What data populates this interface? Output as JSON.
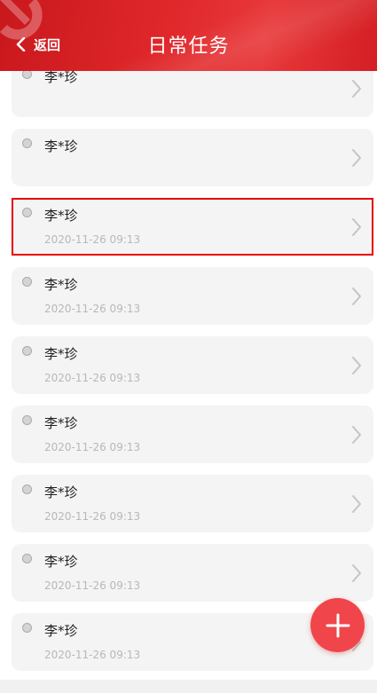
{
  "header": {
    "back_label": "返回",
    "title": "日常任务",
    "back_icon": "chevron-left-icon",
    "background_color": "#d9252a"
  },
  "tasks": [
    {
      "name": "李*珍",
      "time": ""
    },
    {
      "name": "李*珍",
      "time": ""
    },
    {
      "name": "李*珍",
      "time": "2020-11-26 09:13",
      "selected": true
    },
    {
      "name": "李*珍",
      "time": "2020-11-26 09:13"
    },
    {
      "name": "李*珍",
      "time": "2020-11-26 09:13"
    },
    {
      "name": "李*珍",
      "time": "2020-11-26 09:13"
    },
    {
      "name": "李*珍",
      "time": "2020-11-26 09:13"
    },
    {
      "name": "李*珍",
      "time": "2020-11-26 09:13"
    },
    {
      "name": "李*珍",
      "time": "2020-11-26 09:13"
    }
  ],
  "fab": {
    "icon": "plus-icon",
    "color": "#f0454a"
  },
  "colors": {
    "selected_outline": "#e60000",
    "card_bg": "#f4f4f4"
  }
}
